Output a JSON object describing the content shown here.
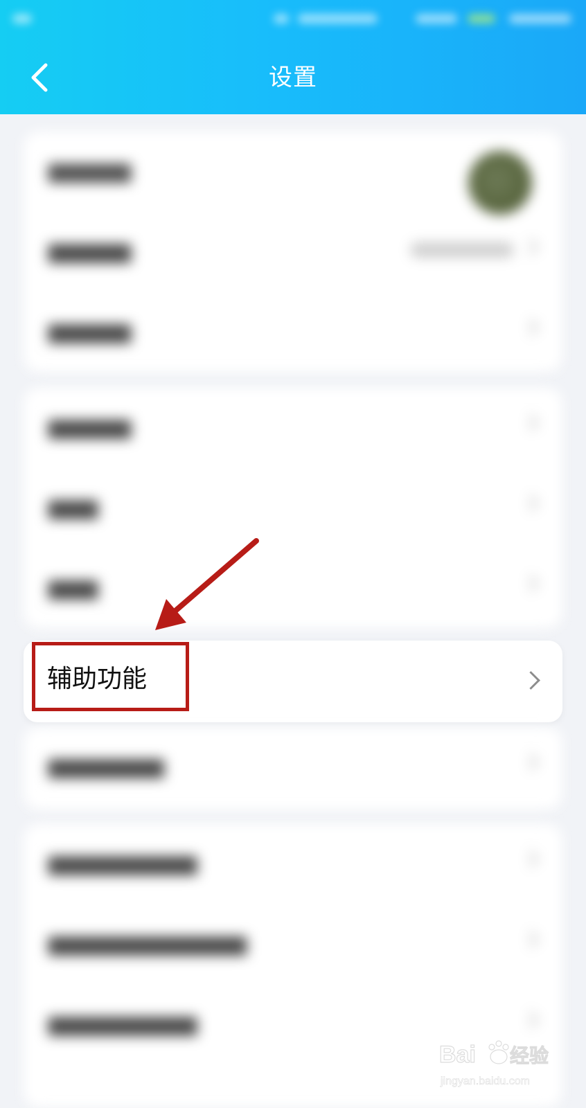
{
  "header": {
    "title": "设置",
    "back_icon": "chevron-left-icon",
    "background_start": "#15cdf3",
    "background_end": "#1aa8f8"
  },
  "main": {
    "highlighted_item": {
      "label": "辅助功能",
      "chevron_icon": "chevron-right-icon"
    },
    "annotation_color": "#b71c17"
  },
  "watermark": {
    "brand": "Baidu经验",
    "domain": "jingyan.baidu.com"
  }
}
